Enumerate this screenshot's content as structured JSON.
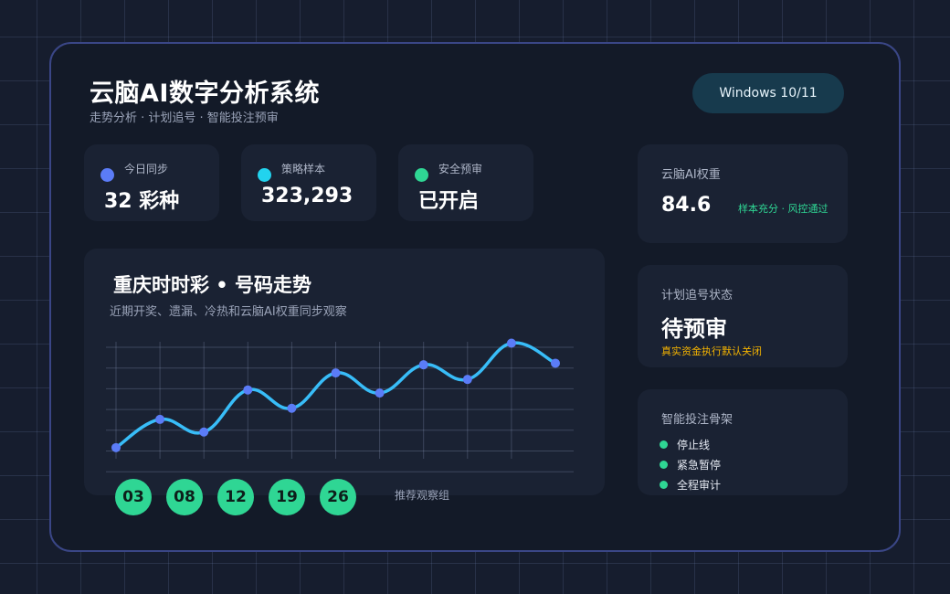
{
  "header": {
    "title": "云脑AI数字分析系统",
    "subtitle": "走势分析 · 计划追号 · 智能投注预审",
    "os_badge": "Windows 10/11"
  },
  "stats": [
    {
      "label": "今日同步",
      "value": "32 彩种",
      "color": "#5b7cf7"
    },
    {
      "label": "策略样本",
      "value": "323,293",
      "color": "#22d3ee"
    },
    {
      "label": "安全预审",
      "value": "已开启",
      "color": "#2fd694"
    }
  ],
  "ai_weight": {
    "label": "云脑AI权重",
    "value": "84.6",
    "note": "样本充分 · 风控通过"
  },
  "plan_status": {
    "label": "计划追号状态",
    "value": "待预审",
    "note": "真实资金执行默认关闭"
  },
  "framework": {
    "label": "智能投注骨架",
    "items": [
      "停止线",
      "紧急暂停",
      "全程审计"
    ]
  },
  "trend": {
    "title": "重庆时时彩 • 号码走势",
    "subtitle": "近期开奖、遗漏、冷热和云脑AI权重同步观察",
    "balls": [
      "03",
      "08",
      "12",
      "19",
      "26"
    ],
    "balls_label": "推荐观察组"
  },
  "colors": {
    "line": "#38bdf8",
    "point": "#5b7cf7",
    "accent_green": "#2fd694",
    "warning": "#f5b400"
  },
  "chart_data": {
    "type": "line",
    "title": "重庆时时彩 • 号码走势",
    "x": [
      1,
      2,
      3,
      4,
      5,
      6,
      7,
      8,
      9,
      10,
      11
    ],
    "series": [
      {
        "values": [
          0.57,
          2.02,
          1.37,
          3.53,
          2.59,
          4.4,
          3.37,
          4.82,
          4.07,
          5.93,
          4.9
        ]
      }
    ],
    "ylim": [
      0,
      6
    ],
    "grid": true,
    "smooth": true
  }
}
